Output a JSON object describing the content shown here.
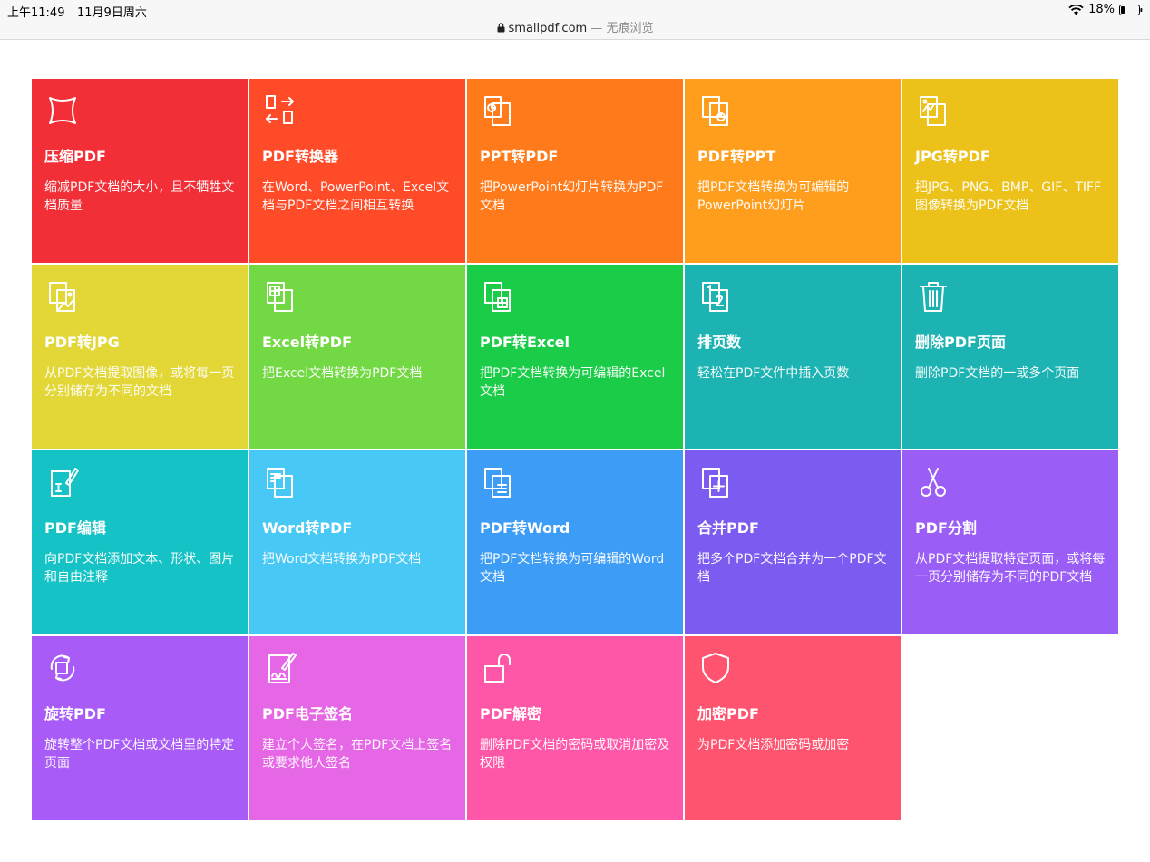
{
  "status": {
    "time": "上午11:49",
    "date": "11月9日周六",
    "battery": "18%"
  },
  "browser": {
    "url": "smallpdf.com",
    "mode": " — 无痕浏览"
  },
  "tools": [
    {
      "title": "压缩PDF",
      "desc": "缩减PDF文档的大小，且不牺牲文档质量",
      "color": "#f22e36",
      "icon": "compress-icon"
    },
    {
      "title": "PDF转换器",
      "desc": "在Word、PowerPoint、Excel文档与PDF文档之间相互转换",
      "color": "#ff4b27",
      "icon": "convert-icon"
    },
    {
      "title": "PPT转PDF",
      "desc": "把PowerPoint幻灯片转换为PDF文档",
      "color": "#ff7a1a",
      "icon": "ppt-to-pdf-icon"
    },
    {
      "title": "PDF转PPT",
      "desc": "把PDF文档转换为可编辑的PowerPoint幻灯片",
      "color": "#ff9d1c",
      "icon": "pdf-to-ppt-icon"
    },
    {
      "title": "JPG转PDF",
      "desc": "把JPG、PNG、BMP、GIF、TIFF图像转换为PDF文档",
      "color": "#ecc21a",
      "icon": "jpg-to-pdf-icon"
    },
    {
      "title": "PDF转JPG",
      "desc": "从PDF文档提取图像，或将每一页分别储存为不同的文档",
      "color": "#e2d737",
      "icon": "pdf-to-jpg-icon"
    },
    {
      "title": "Excel转PDF",
      "desc": "把Excel文档转换为PDF文档",
      "color": "#72d844",
      "icon": "excel-to-pdf-icon"
    },
    {
      "title": "PDF转Excel",
      "desc": "把PDF文档转换为可编辑的Excel文档",
      "color": "#1acc47",
      "icon": "pdf-to-excel-icon"
    },
    {
      "title": "排页数",
      "desc": "轻松在PDF文件中插入页数",
      "color": "#1eb3b3",
      "icon": "page-numbers-icon"
    },
    {
      "title": "删除PDF页面",
      "desc": "删除PDF文档的一或多个页面",
      "color": "#1eb3b3",
      "icon": "trash-icon"
    },
    {
      "title": "PDF编辑",
      "desc": "向PDF文档添加文本、形状、图片和自由注释",
      "color": "#15c3c6",
      "icon": "edit-icon"
    },
    {
      "title": "Word转PDF",
      "desc": "把Word文档转换为PDF文档",
      "color": "#47c8f5",
      "icon": "word-to-pdf-icon"
    },
    {
      "title": "PDF转Word",
      "desc": "把PDF文档转换为可编辑的Word文档",
      "color": "#3d9cf5",
      "icon": "pdf-to-word-icon"
    },
    {
      "title": "合并PDF",
      "desc": "把多个PDF文档合并为一个PDF文档",
      "color": "#7c5cf0",
      "icon": "merge-icon"
    },
    {
      "title": "PDF分割",
      "desc": "从PDF文档提取特定页面，或将每一页分别储存为不同的PDF文档",
      "color": "#9a5ef7",
      "icon": "scissors-icon"
    },
    {
      "title": "旋转PDF",
      "desc": "旋转整个PDF文档或文档里的特定页面",
      "color": "#a85bf6",
      "icon": "rotate-icon"
    },
    {
      "title": "PDF电子签名",
      "desc": "建立个人签名，在PDF文档上签名或要求他人签名",
      "color": "#e667e6",
      "icon": "signature-icon"
    },
    {
      "title": "PDF解密",
      "desc": "删除PDF文档的密码或取消加密及权限",
      "color": "#ff57a8",
      "icon": "unlock-icon"
    },
    {
      "title": "加密PDF",
      "desc": "为PDF文档添加密码或加密",
      "color": "#ff5470",
      "icon": "shield-icon"
    }
  ]
}
